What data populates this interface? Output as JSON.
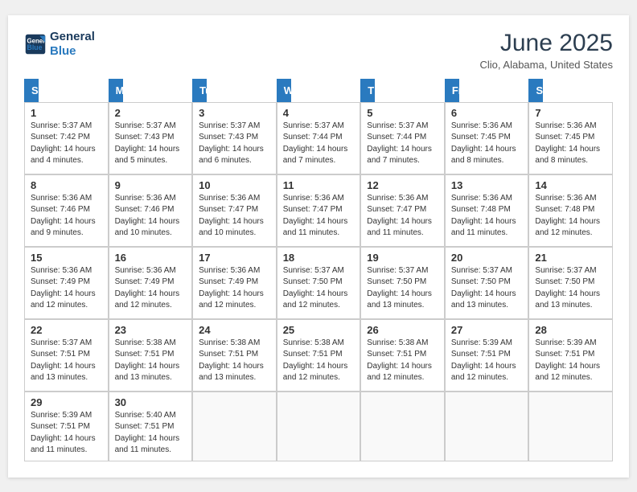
{
  "header": {
    "logo_line1": "General",
    "logo_line2": "Blue",
    "title": "June 2025",
    "location": "Clio, Alabama, United States"
  },
  "days": [
    "Sunday",
    "Monday",
    "Tuesday",
    "Wednesday",
    "Thursday",
    "Friday",
    "Saturday"
  ],
  "weeks": [
    [
      {
        "num": "1",
        "sunrise": "5:37 AM",
        "sunset": "7:42 PM",
        "daylight": "14 hours and 4 minutes."
      },
      {
        "num": "2",
        "sunrise": "5:37 AM",
        "sunset": "7:43 PM",
        "daylight": "14 hours and 5 minutes."
      },
      {
        "num": "3",
        "sunrise": "5:37 AM",
        "sunset": "7:43 PM",
        "daylight": "14 hours and 6 minutes."
      },
      {
        "num": "4",
        "sunrise": "5:37 AM",
        "sunset": "7:44 PM",
        "daylight": "14 hours and 7 minutes."
      },
      {
        "num": "5",
        "sunrise": "5:37 AM",
        "sunset": "7:44 PM",
        "daylight": "14 hours and 7 minutes."
      },
      {
        "num": "6",
        "sunrise": "5:36 AM",
        "sunset": "7:45 PM",
        "daylight": "14 hours and 8 minutes."
      },
      {
        "num": "7",
        "sunrise": "5:36 AM",
        "sunset": "7:45 PM",
        "daylight": "14 hours and 8 minutes."
      }
    ],
    [
      {
        "num": "8",
        "sunrise": "5:36 AM",
        "sunset": "7:46 PM",
        "daylight": "14 hours and 9 minutes."
      },
      {
        "num": "9",
        "sunrise": "5:36 AM",
        "sunset": "7:46 PM",
        "daylight": "14 hours and 10 minutes."
      },
      {
        "num": "10",
        "sunrise": "5:36 AM",
        "sunset": "7:47 PM",
        "daylight": "14 hours and 10 minutes."
      },
      {
        "num": "11",
        "sunrise": "5:36 AM",
        "sunset": "7:47 PM",
        "daylight": "14 hours and 11 minutes."
      },
      {
        "num": "12",
        "sunrise": "5:36 AM",
        "sunset": "7:47 PM",
        "daylight": "14 hours and 11 minutes."
      },
      {
        "num": "13",
        "sunrise": "5:36 AM",
        "sunset": "7:48 PM",
        "daylight": "14 hours and 11 minutes."
      },
      {
        "num": "14",
        "sunrise": "5:36 AM",
        "sunset": "7:48 PM",
        "daylight": "14 hours and 12 minutes."
      }
    ],
    [
      {
        "num": "15",
        "sunrise": "5:36 AM",
        "sunset": "7:49 PM",
        "daylight": "14 hours and 12 minutes."
      },
      {
        "num": "16",
        "sunrise": "5:36 AM",
        "sunset": "7:49 PM",
        "daylight": "14 hours and 12 minutes."
      },
      {
        "num": "17",
        "sunrise": "5:36 AM",
        "sunset": "7:49 PM",
        "daylight": "14 hours and 12 minutes."
      },
      {
        "num": "18",
        "sunrise": "5:37 AM",
        "sunset": "7:50 PM",
        "daylight": "14 hours and 12 minutes."
      },
      {
        "num": "19",
        "sunrise": "5:37 AM",
        "sunset": "7:50 PM",
        "daylight": "14 hours and 13 minutes."
      },
      {
        "num": "20",
        "sunrise": "5:37 AM",
        "sunset": "7:50 PM",
        "daylight": "14 hours and 13 minutes."
      },
      {
        "num": "21",
        "sunrise": "5:37 AM",
        "sunset": "7:50 PM",
        "daylight": "14 hours and 13 minutes."
      }
    ],
    [
      {
        "num": "22",
        "sunrise": "5:37 AM",
        "sunset": "7:51 PM",
        "daylight": "14 hours and 13 minutes."
      },
      {
        "num": "23",
        "sunrise": "5:38 AM",
        "sunset": "7:51 PM",
        "daylight": "14 hours and 13 minutes."
      },
      {
        "num": "24",
        "sunrise": "5:38 AM",
        "sunset": "7:51 PM",
        "daylight": "14 hours and 13 minutes."
      },
      {
        "num": "25",
        "sunrise": "5:38 AM",
        "sunset": "7:51 PM",
        "daylight": "14 hours and 12 minutes."
      },
      {
        "num": "26",
        "sunrise": "5:38 AM",
        "sunset": "7:51 PM",
        "daylight": "14 hours and 12 minutes."
      },
      {
        "num": "27",
        "sunrise": "5:39 AM",
        "sunset": "7:51 PM",
        "daylight": "14 hours and 12 minutes."
      },
      {
        "num": "28",
        "sunrise": "5:39 AM",
        "sunset": "7:51 PM",
        "daylight": "14 hours and 12 minutes."
      }
    ],
    [
      {
        "num": "29",
        "sunrise": "5:39 AM",
        "sunset": "7:51 PM",
        "daylight": "14 hours and 11 minutes."
      },
      {
        "num": "30",
        "sunrise": "5:40 AM",
        "sunset": "7:51 PM",
        "daylight": "14 hours and 11 minutes."
      },
      null,
      null,
      null,
      null,
      null
    ]
  ],
  "labels": {
    "sunrise_prefix": "Sunrise: ",
    "sunset_prefix": "Sunset: ",
    "daylight_prefix": "Daylight: "
  }
}
